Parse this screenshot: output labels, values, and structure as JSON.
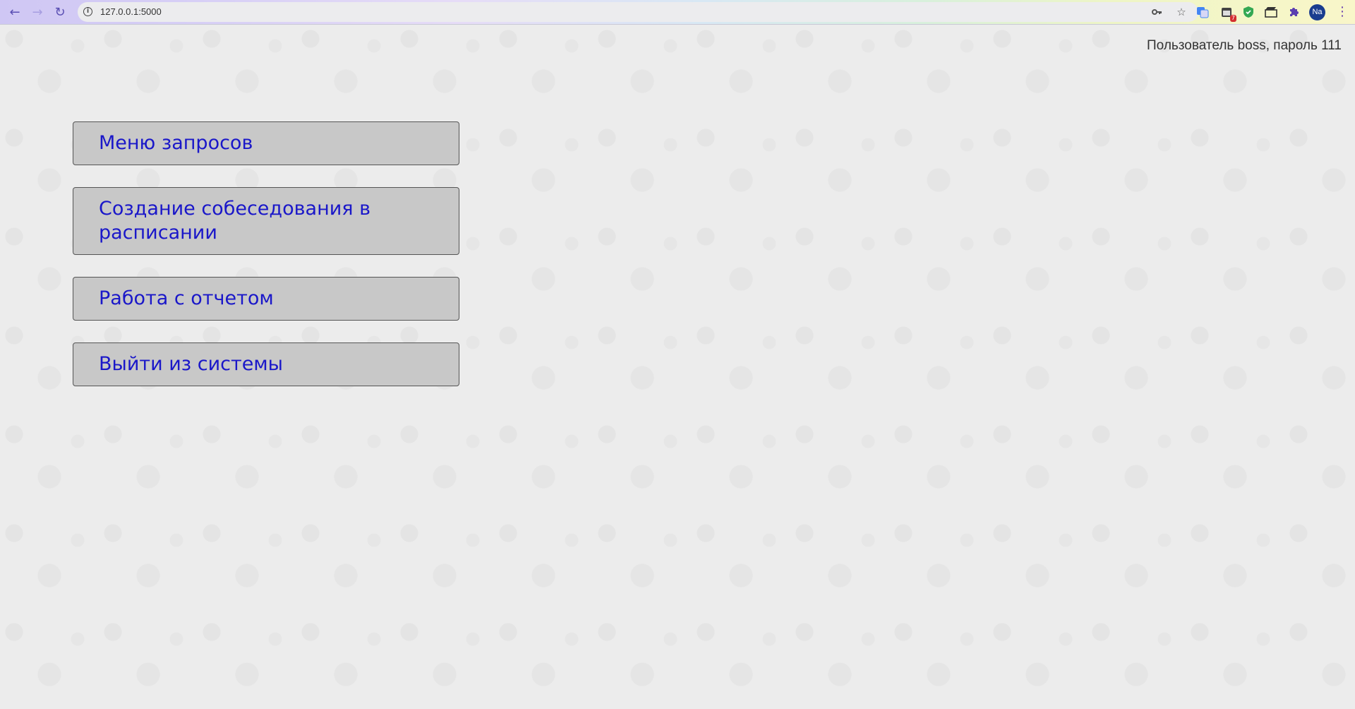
{
  "browser": {
    "url": "127.0.0.1:5000",
    "profile_initials": "Na",
    "extension_badge": "7"
  },
  "page": {
    "user_info": "Пользователь boss, пароль 111",
    "menu": [
      {
        "label": "Меню запросов"
      },
      {
        "label": "Создание собеседования в расписании"
      },
      {
        "label": "Работа с отчетом"
      },
      {
        "label": "Выйти из системы"
      }
    ]
  },
  "colors": {
    "button_text": "#1a17c9",
    "button_bg": "#c8c8c8",
    "page_bg": "#ececec"
  }
}
